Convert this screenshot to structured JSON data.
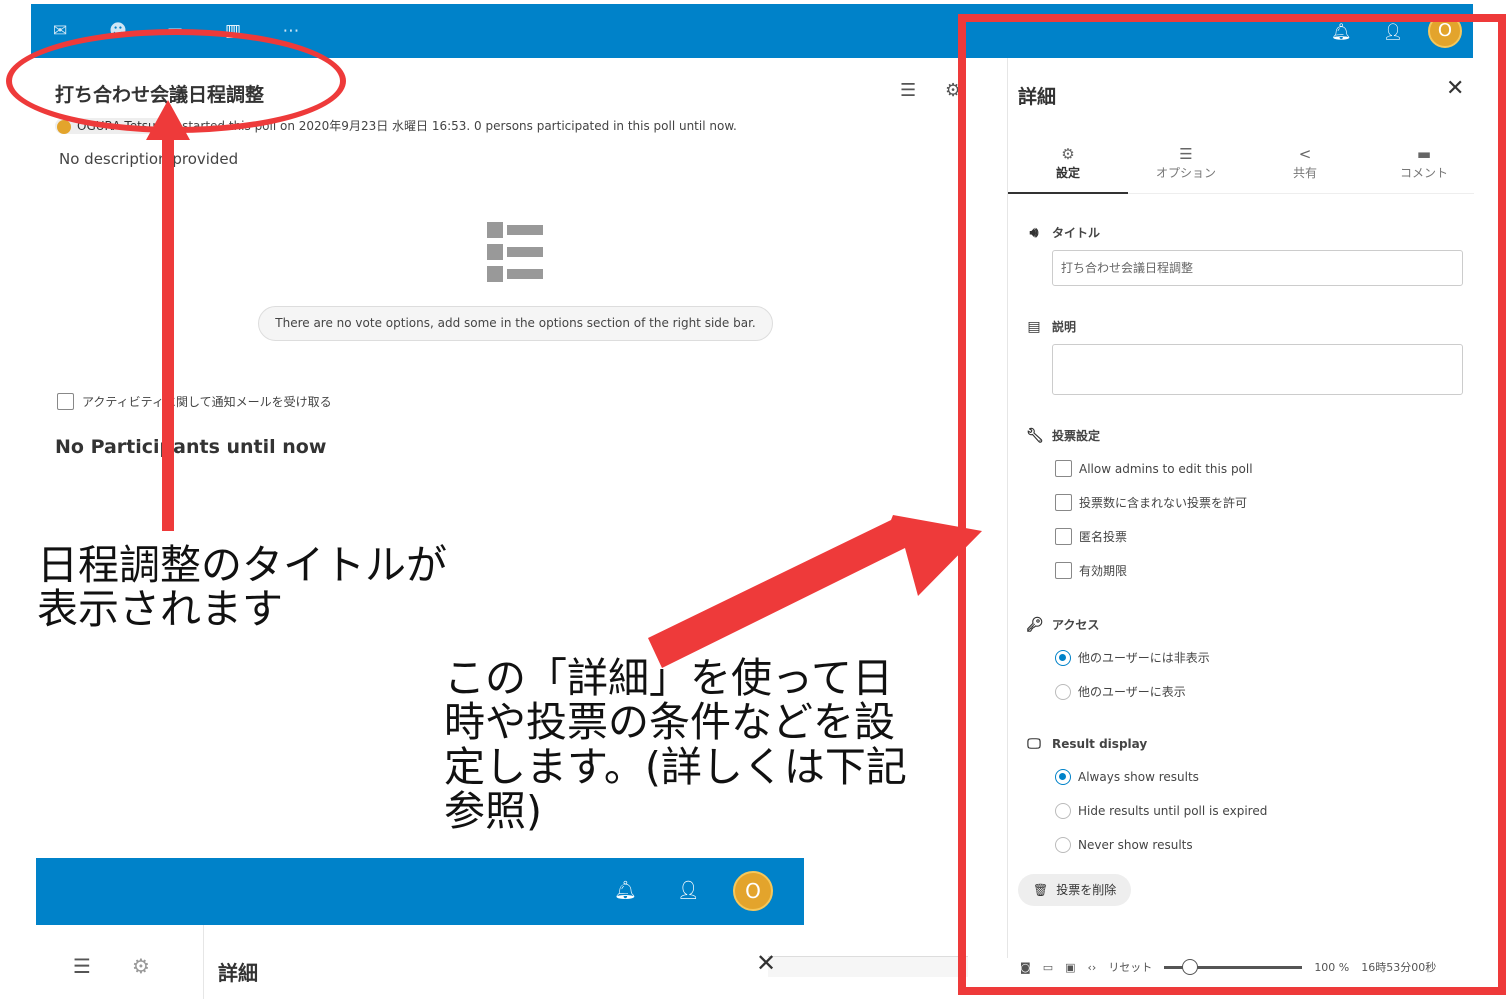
{
  "poll": {
    "title": "打ち合わせ会議日程調整",
    "owner": "OGURA Tetsuya",
    "meta": "started this poll on 2020年9月23日 水曜日 16:53. 0 persons participated in this poll until now.",
    "description": "No description provided",
    "no_options_message": "There are no vote options, add some in the options section of the right side bar.",
    "notify_label": "アクティビティに関して通知メールを受け取る",
    "no_participants": "No Participants until now"
  },
  "header": {
    "avatar_letter": "O",
    "apps": [
      "mail-icon",
      "contacts-icon",
      "calendar-icon",
      "polls-icon",
      "more-icon"
    ]
  },
  "sidebar": {
    "title": "詳細",
    "close": "✕",
    "tabs": [
      {
        "label": "設定",
        "icon": "gear-icon"
      },
      {
        "label": "オプション",
        "icon": "list-icon"
      },
      {
        "label": "共有",
        "icon": "share-icon"
      },
      {
        "label": "コメント",
        "icon": "comment-icon"
      }
    ],
    "title_section": "タイトル",
    "title_value": "打ち合わせ会議日程調整",
    "description_section": "説明",
    "voting_section": "投票設定",
    "voting_options": [
      "Allow admins to edit this poll",
      "投票数に含まれない投票を許可",
      "匿名投票",
      "有効期限"
    ],
    "access_section": "アクセス",
    "access_options": [
      "他のユーザーには非表示",
      "他のユーザーに表示"
    ],
    "access_selected": 0,
    "result_section": "Result display",
    "result_options": [
      "Always show results",
      "Hide results until poll is expired",
      "Never show results"
    ],
    "result_selected": 0,
    "delete_label": "投票を削除"
  },
  "statusbar": {
    "reset": "リセット",
    "zoom": "100 %",
    "time": "16時53分00秒"
  },
  "annotations": {
    "title_note": "日程調整のタイトルが\n表示されます",
    "detail_note": "この「詳細」を使って日時や投票の条件などを設定します。(詳しくは下記参照)"
  },
  "lower": {
    "avatar_letter": "O",
    "title": "詳細",
    "close": "✕"
  },
  "colors": {
    "header_blue": "#0082c9",
    "annotation_red": "#ee3a3a",
    "avatar": "#e3a42c"
  }
}
